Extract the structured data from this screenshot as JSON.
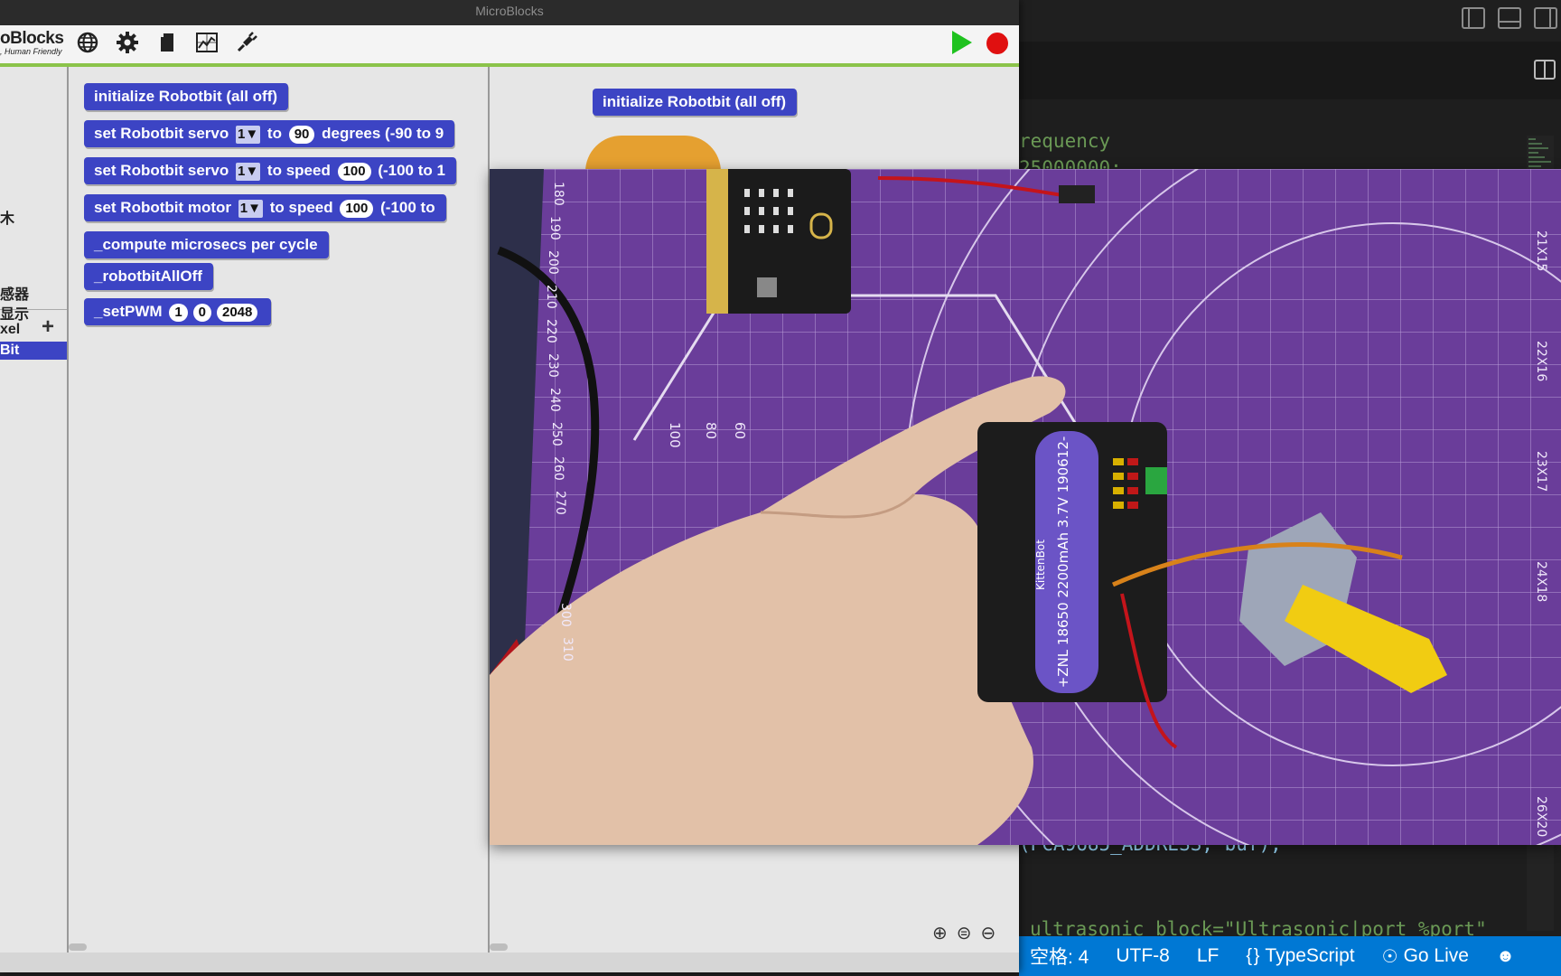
{
  "microblocks": {
    "window_title": "MicroBlocks",
    "logo_name": "oBlocks",
    "logo_tagline": ", Human Friendly",
    "categories": [
      "木",
      "感器",
      "显示",
      "xel",
      "Bit"
    ],
    "palette_blocks": [
      {
        "label": "initialize Robotbit (all off)"
      },
      {
        "prefix": "set Robotbit servo",
        "dropdown": "1▼",
        "mid": "to",
        "value": "90",
        "suffix": "degrees (-90 to 9"
      },
      {
        "prefix": "set Robotbit servo",
        "dropdown": "1▼",
        "mid": "to speed",
        "value": "100",
        "suffix": "(-100 to 1"
      },
      {
        "prefix": "set Robotbit motor",
        "dropdown": "1▼",
        "mid": "to speed",
        "value": "100",
        "suffix": "(-100 to"
      },
      {
        "label": "_compute microsecs per cycle"
      },
      {
        "label": "_robotbitAllOff"
      },
      {
        "prefix": "_setPWM",
        "v1": "1",
        "v2": "0",
        "v3": "2048"
      }
    ],
    "script_block": "initialize Robotbit (all off)",
    "colors": {
      "block": "#3c44c4",
      "run": "#1fc21f",
      "stop": "#e01010",
      "accent_bar": "#8bc34a"
    }
  },
  "vscode": {
    "code_lines": [
      {
        "text": "requency",
        "kind": "comment"
      },
      {
        "text": "25000000;",
        "kind": "comment"
      },
      {
        "text": "(PCA9685_ADDRESS, buf);",
        "kind": "text"
      },
      {
        "text": "ultrasonic block=\"Ultrasonic|port %port\"",
        "kind": "comment"
      }
    ],
    "status": {
      "spaces": "空格: 4",
      "encoding": "UTF-8",
      "eol": "LF",
      "language": "TypeScript",
      "golive": "Go Live"
    },
    "colors": {
      "statusbar": "#0078d4"
    }
  },
  "video": {
    "board_label": "+ZNL 18650 2200mAh 3.7V 190612-",
    "brand": "KittenBot",
    "ruler_marks": [
      "180",
      "190",
      "200",
      "210",
      "220",
      "230",
      "240",
      "250",
      "260",
      "270",
      "300",
      "310"
    ],
    "grid_marks": [
      "100",
      "80",
      "60"
    ],
    "right_marks": [
      "21X15",
      "22X16",
      "23X17",
      "24X18",
      "26X20"
    ]
  }
}
